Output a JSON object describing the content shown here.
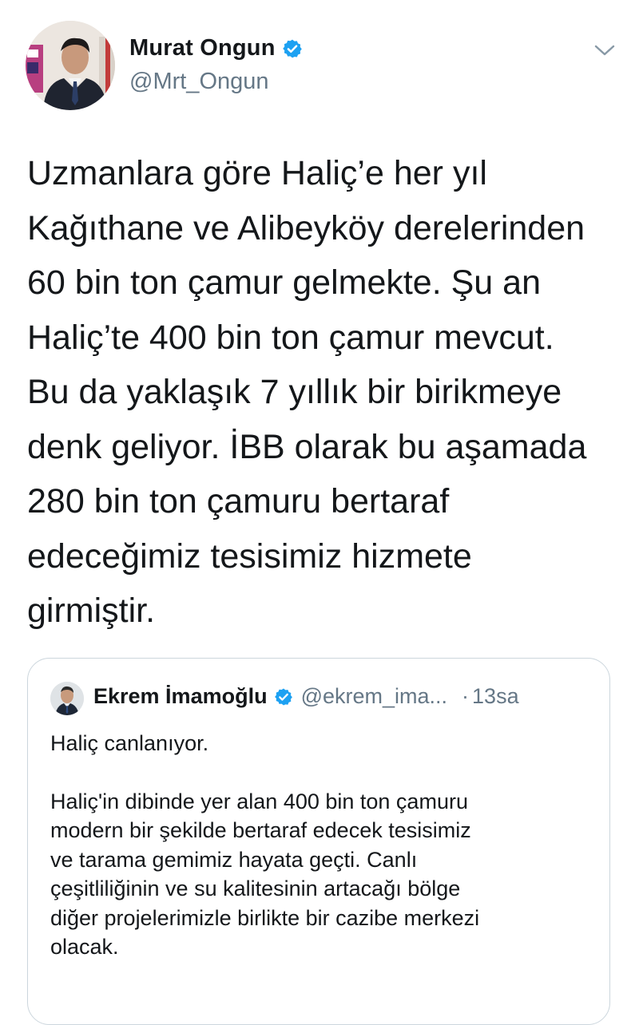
{
  "tweet": {
    "author": {
      "name": "Murat Ongun",
      "handle": "@Mrt_Ongun",
      "verified": true
    },
    "text": "Uzmanlara göre Haliç’e her yıl\nKağıthane ve Alibeyköy derelerinden\n60 bin ton çamur gelmekte. Şu an\nHaliç’te 400 bin ton çamur mevcut.\nBu da yaklaşık 7 yıllık bir birikmeye\ndenk geliyor. İBB olarak bu aşamada\n280 bin ton çamuru bertaraf\nedeceğimiz tesisimiz hizmete\ngirmiştir.",
    "menu_icon": "chevron-down-icon"
  },
  "quoted_tweet": {
    "author": {
      "name": "Ekrem İmamoğlu",
      "handle": "@ekrem_ima...",
      "verified": true
    },
    "separator": "·",
    "time": "13sa",
    "text_paragraph_1": "Haliç canlanıyor.",
    "text_paragraph_2": "Haliç'in dibinde yer alan 400 bin ton çamuru\nmodern bir şekilde bertaraf edecek tesisimiz\nve tarama gemimiz hayata geçti. Canlı\nçeşitliliğinin ve su kalitesinin artacağı bölge\ndiğer projelerimizle birlikte bir cazibe merkezi\nolacak."
  },
  "colors": {
    "text_primary": "#14171a",
    "text_secondary": "#657786",
    "verified_blue": "#1da1f2",
    "border": "#ccd6dd"
  }
}
